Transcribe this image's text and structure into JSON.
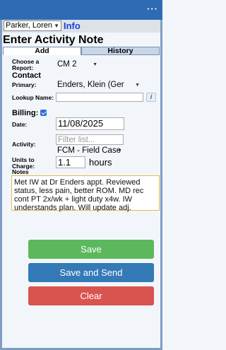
{
  "topbar": {
    "menu_icon": "more-horizontal-icon",
    "menu_text": "···"
  },
  "client": {
    "selected": "Parker, Loren",
    "info_link": "Info"
  },
  "page": {
    "title": "Enter Activity Note"
  },
  "tabs": [
    {
      "label": "Add",
      "active": true
    },
    {
      "label": "History",
      "active": false
    }
  ],
  "report": {
    "label_line1": "Choose a",
    "label_line2": "Report:",
    "value": "CM 2"
  },
  "contact": {
    "section": "Contact",
    "primary_label": "Primary:",
    "primary_value": "Enders, Klein (Ger",
    "lookup_label": "Lookup Name:",
    "lookup_value": "",
    "info_button": "i"
  },
  "billing": {
    "label": "Billing:",
    "checked": true
  },
  "date": {
    "label": "Date:",
    "value": "11/08/2025"
  },
  "activity": {
    "label": "Activity:",
    "filter_placeholder": "Filter list...",
    "value": "FCM - Field Case"
  },
  "units": {
    "label_line1": "Units to",
    "label_line2": "Charge:",
    "value": "1.1",
    "suffix": "hours"
  },
  "notes": {
    "label": "Notes",
    "text": "Met IW at Dr Enders appt. Reviewed status, less pain, better ROM. MD rec cont PT 2x/wk + light duty x4w. IW understands plan. Will update adj."
  },
  "buttons": {
    "save": "Save",
    "save_send": "Save and Send",
    "clear": "Clear"
  },
  "colors": {
    "topbar": "#2e6bb4",
    "save": "#5cb85c",
    "save_send": "#337ab7",
    "clear": "#d9534f",
    "info_link": "#1a3fd8",
    "notes_border": "#e4b84a"
  }
}
